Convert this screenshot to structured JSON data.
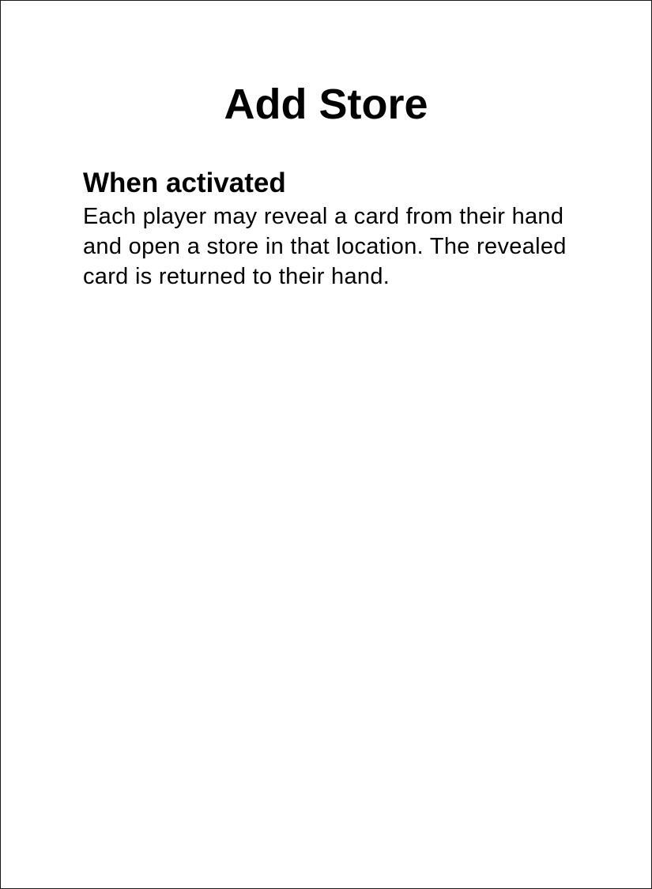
{
  "card": {
    "title": "Add Store",
    "section_heading": "When activated",
    "section_text": "Each player may reveal a card from their hand and open a store in that location. The revealed card is returned to their hand."
  }
}
